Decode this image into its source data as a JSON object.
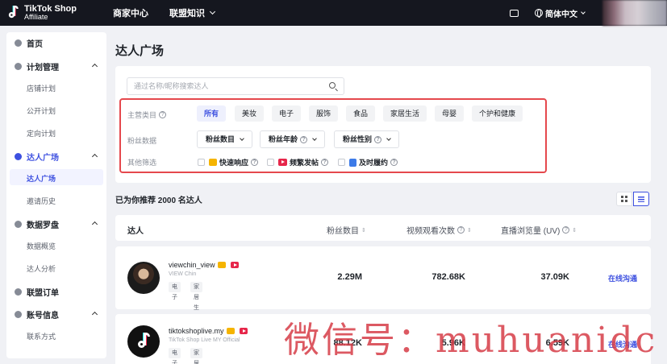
{
  "brand": {
    "line1": "TikTok Shop",
    "line2": "Affiliate"
  },
  "topnav": {
    "merchant_center": "商家中心",
    "alliance_knowledge": "联盟知识",
    "language": "简体中文"
  },
  "sidebar": {
    "home": "首页",
    "plan_management": "计划管理",
    "store_plan": "店铺计划",
    "public_plan": "公开计划",
    "targeted_plan": "定向计划",
    "creator_square": "达人广场",
    "creator_square_sub": "达人广场",
    "invite_history": "邀请历史",
    "data_compass": "数据罗盘",
    "data_overview": "数据概览",
    "creator_analysis": "达人分析",
    "alliance_orders": "联盟订单",
    "account_info": "账号信息",
    "contact": "联系方式"
  },
  "page": {
    "title": "达人广场",
    "recommend_text": "已为你推荐 2000 名达人"
  },
  "search": {
    "placeholder": "通过名称/昵称搜索达人"
  },
  "filters": {
    "category_label": "主营类目",
    "categories": [
      "所有",
      "美妆",
      "电子",
      "服饰",
      "食品",
      "家居生活",
      "母婴",
      "个护和健康"
    ],
    "fans_label": "粉丝数据",
    "fans_dropdowns": [
      "粉丝数目",
      "粉丝年龄",
      "粉丝性别"
    ],
    "other_label": "其他筛选",
    "others": [
      "快速响应",
      "频繁发帖",
      "及时履约"
    ]
  },
  "table": {
    "headers": {
      "creator": "达人",
      "followers": "粉丝数目",
      "video_views": "视频观看次数",
      "live_views": "直播浏览量 (UV)"
    },
    "rows": [
      {
        "name": "viewchin_view",
        "display": "VIEW Chin",
        "tags": [
          "电子",
          "家居生活"
        ],
        "followers": "2.29M",
        "video_views": "782.68K",
        "live_views": "37.09K",
        "action": "在线沟通"
      },
      {
        "name": "tiktokshoplive.my",
        "display": "TikTok Shop Live MY Official",
        "tags": [
          "电子",
          "家居生活"
        ],
        "followers": "88.12K",
        "video_views": "5.96K",
        "live_views": "6.59K",
        "action": "在线沟通"
      }
    ]
  },
  "watermark": "微信号：muhuanidc",
  "colors": {
    "accent": "#3d50e0",
    "highlight_border": "#e5484d",
    "topbar": "#15171f"
  },
  "icons": {
    "search": "search-icon",
    "help": "help-icon",
    "globe": "globe-icon",
    "message": "message-icon"
  }
}
